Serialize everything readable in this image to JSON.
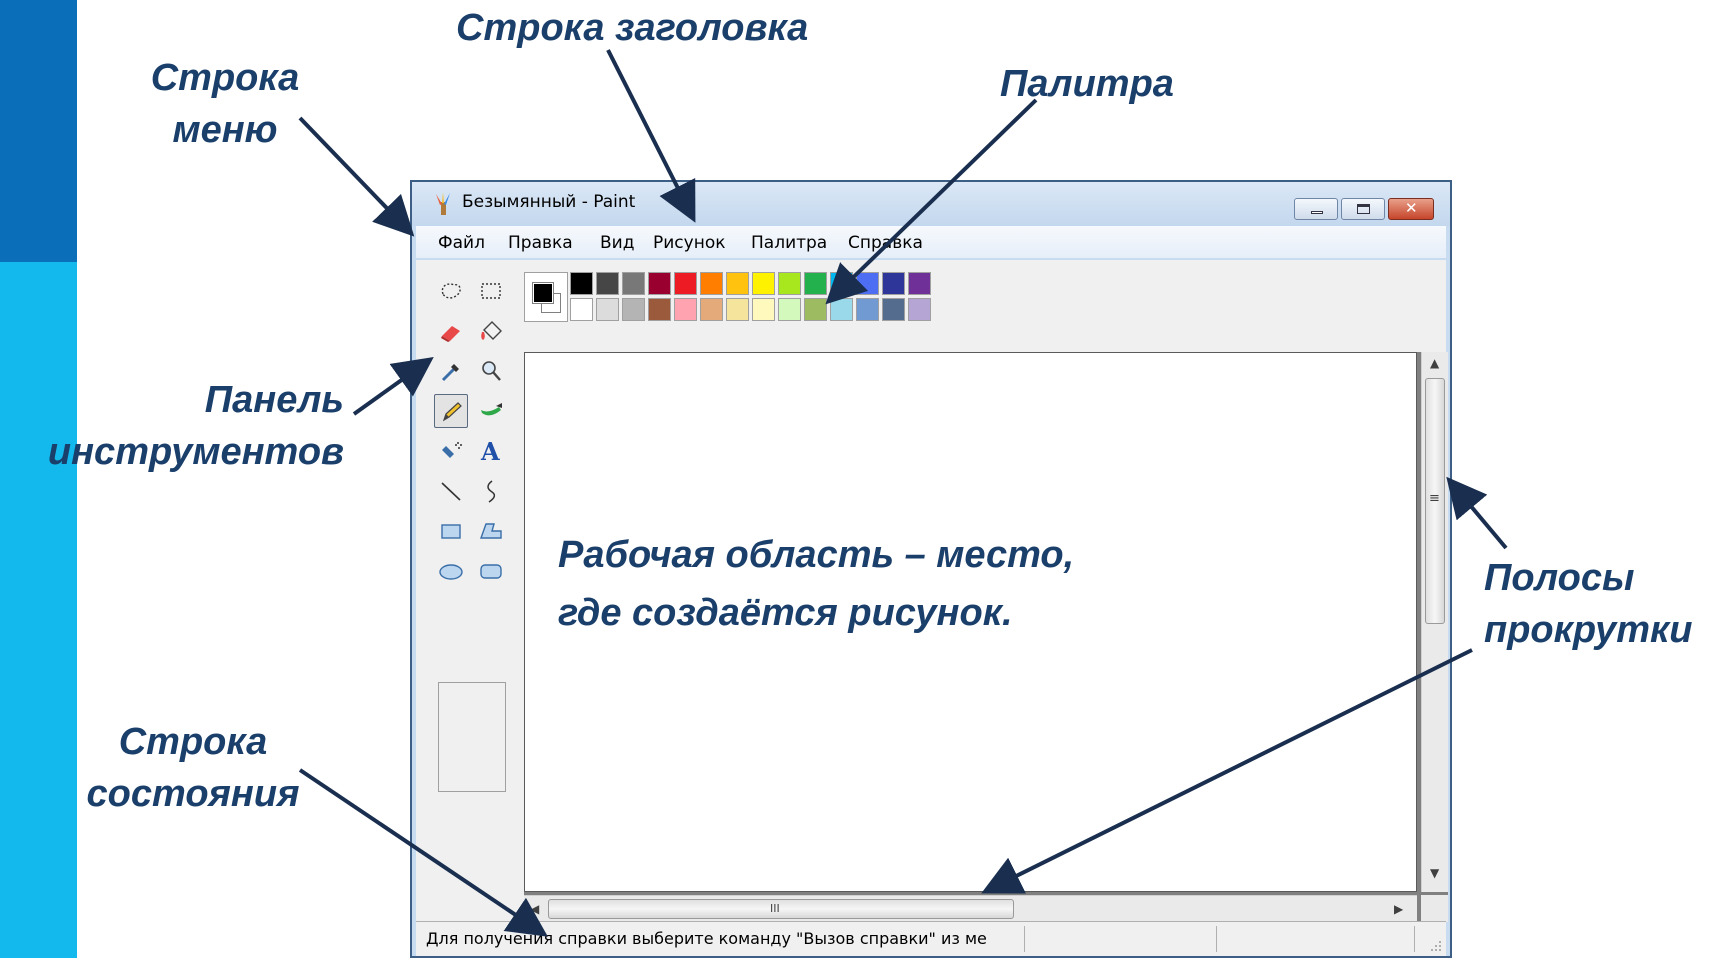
{
  "annotations": {
    "title_bar": "Строка заголовка",
    "menu_bar": [
      "Строка",
      "меню"
    ],
    "palette": "Палитра",
    "toolbar": [
      "Панель",
      "инструментов"
    ],
    "scrollbars": [
      "Полосы",
      "прокрутки"
    ],
    "status_bar": [
      "Строка",
      "состояния"
    ],
    "work_area": [
      "Рабочая область – место,",
      "где создаётся рисунок."
    ]
  },
  "window": {
    "title": "Безымянный - Paint"
  },
  "menu": [
    "Файл",
    "Правка",
    "Вид",
    "Рисунок",
    "Палитра",
    "Справка"
  ],
  "tools": [
    "free-select-icon",
    "rect-select-icon",
    "eraser-icon",
    "fill-bucket-icon",
    "color-picker-icon",
    "magnifier-icon",
    "pencil-icon",
    "brush-icon",
    "airbrush-icon",
    "text-icon",
    "line-icon",
    "curve-icon",
    "rectangle-icon",
    "polygon-icon",
    "ellipse-icon",
    "rounded-rect-icon"
  ],
  "palette": {
    "foreground": "#000000",
    "background": "#ffffff",
    "top_row": [
      "#000000",
      "#464646",
      "#787878",
      "#990030",
      "#ed1c24",
      "#ff7e00",
      "#ffc20e",
      "#fff200",
      "#a8e61d",
      "#22b14c",
      "#00b7ef",
      "#4d6df3",
      "#2f3699",
      "#6f3198"
    ],
    "bottom_row": [
      "#ffffff",
      "#dcdcdc",
      "#b4b4b4",
      "#9c5a3c",
      "#ffa3b1",
      "#e5aa7a",
      "#f5e49c",
      "#fff9bd",
      "#d3f9bc",
      "#9dbb61",
      "#99d9ea",
      "#709ad1",
      "#546d8e",
      "#b5a5d5"
    ]
  },
  "scrollbars": {
    "horizontal_grip": "III",
    "vertical_grip": "≡"
  },
  "status": {
    "text": "Для получения справки выберите команду \"Вызов справки\" из ме"
  }
}
